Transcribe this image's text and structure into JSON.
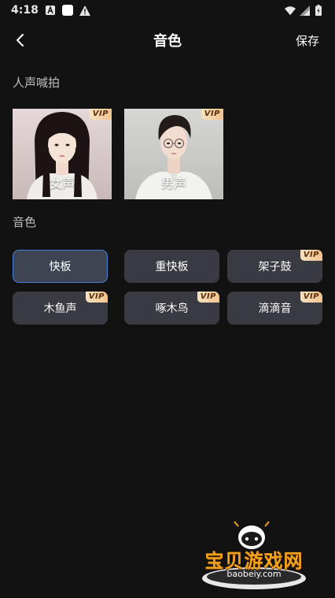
{
  "status_bar": {
    "time": "4:18"
  },
  "header": {
    "title": "音色",
    "save_label": "保存"
  },
  "sections": {
    "voice_title": "人声喊拍",
    "tone_title": "音色"
  },
  "voice_cards": [
    {
      "label": "女声",
      "vip": "VIP"
    },
    {
      "label": "男声",
      "vip": "VIP"
    }
  ],
  "tones": [
    {
      "label": "快板",
      "selected": true
    },
    {
      "label": "重快板"
    },
    {
      "label": "架子鼓",
      "vip": "VIP"
    },
    {
      "label": "木鱼声",
      "vip": "VIP"
    },
    {
      "label": "啄木鸟",
      "vip": "VIP"
    },
    {
      "label": "滴滴音",
      "vip": "VIP"
    }
  ],
  "watermark": {
    "text": "宝贝游戏网",
    "url": "baobeiy.com"
  },
  "colors": {
    "background": "#121212",
    "button_bg": "#3a3a42",
    "selected_border": "#4a7fd6",
    "vip_gold": "#f0c48f"
  }
}
